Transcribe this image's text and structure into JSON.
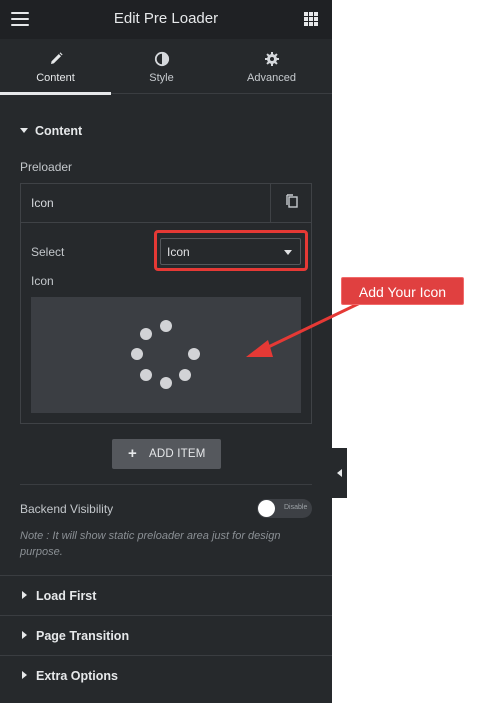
{
  "header": {
    "title": "Edit Pre Loader",
    "menu_icon": "hamburger-icon",
    "apps_icon": "grid-icon"
  },
  "tabs": [
    {
      "label": "Content",
      "icon": "pencil-icon",
      "active": true
    },
    {
      "label": "Style",
      "icon": "half-circle-icon",
      "active": false
    },
    {
      "label": "Advanced",
      "icon": "gear-icon",
      "active": false
    }
  ],
  "content_section": {
    "title": "Content",
    "preloader_label": "Preloader",
    "item": {
      "title": "Icon",
      "select_label": "Select",
      "select_value": "Icon",
      "icon_label": "Icon",
      "preview_icon": "spinner-dots-icon"
    },
    "add_item_label": "ADD ITEM",
    "backend_visibility_label": "Backend Visibility",
    "toggle_text": "Disable",
    "note": "Note : It will show static preloader area just for design purpose."
  },
  "collapsed_sections": [
    {
      "title": "Load First"
    },
    {
      "title": "Page Transition"
    },
    {
      "title": "Extra Options"
    }
  ],
  "annotation": {
    "callout_text": "Add Your Icon",
    "color": "#e53935"
  },
  "colors": {
    "panel_bg": "#26292c",
    "header_bg": "#1f2124",
    "preview_bg": "#3b3e43",
    "button_bg": "#55585d"
  }
}
